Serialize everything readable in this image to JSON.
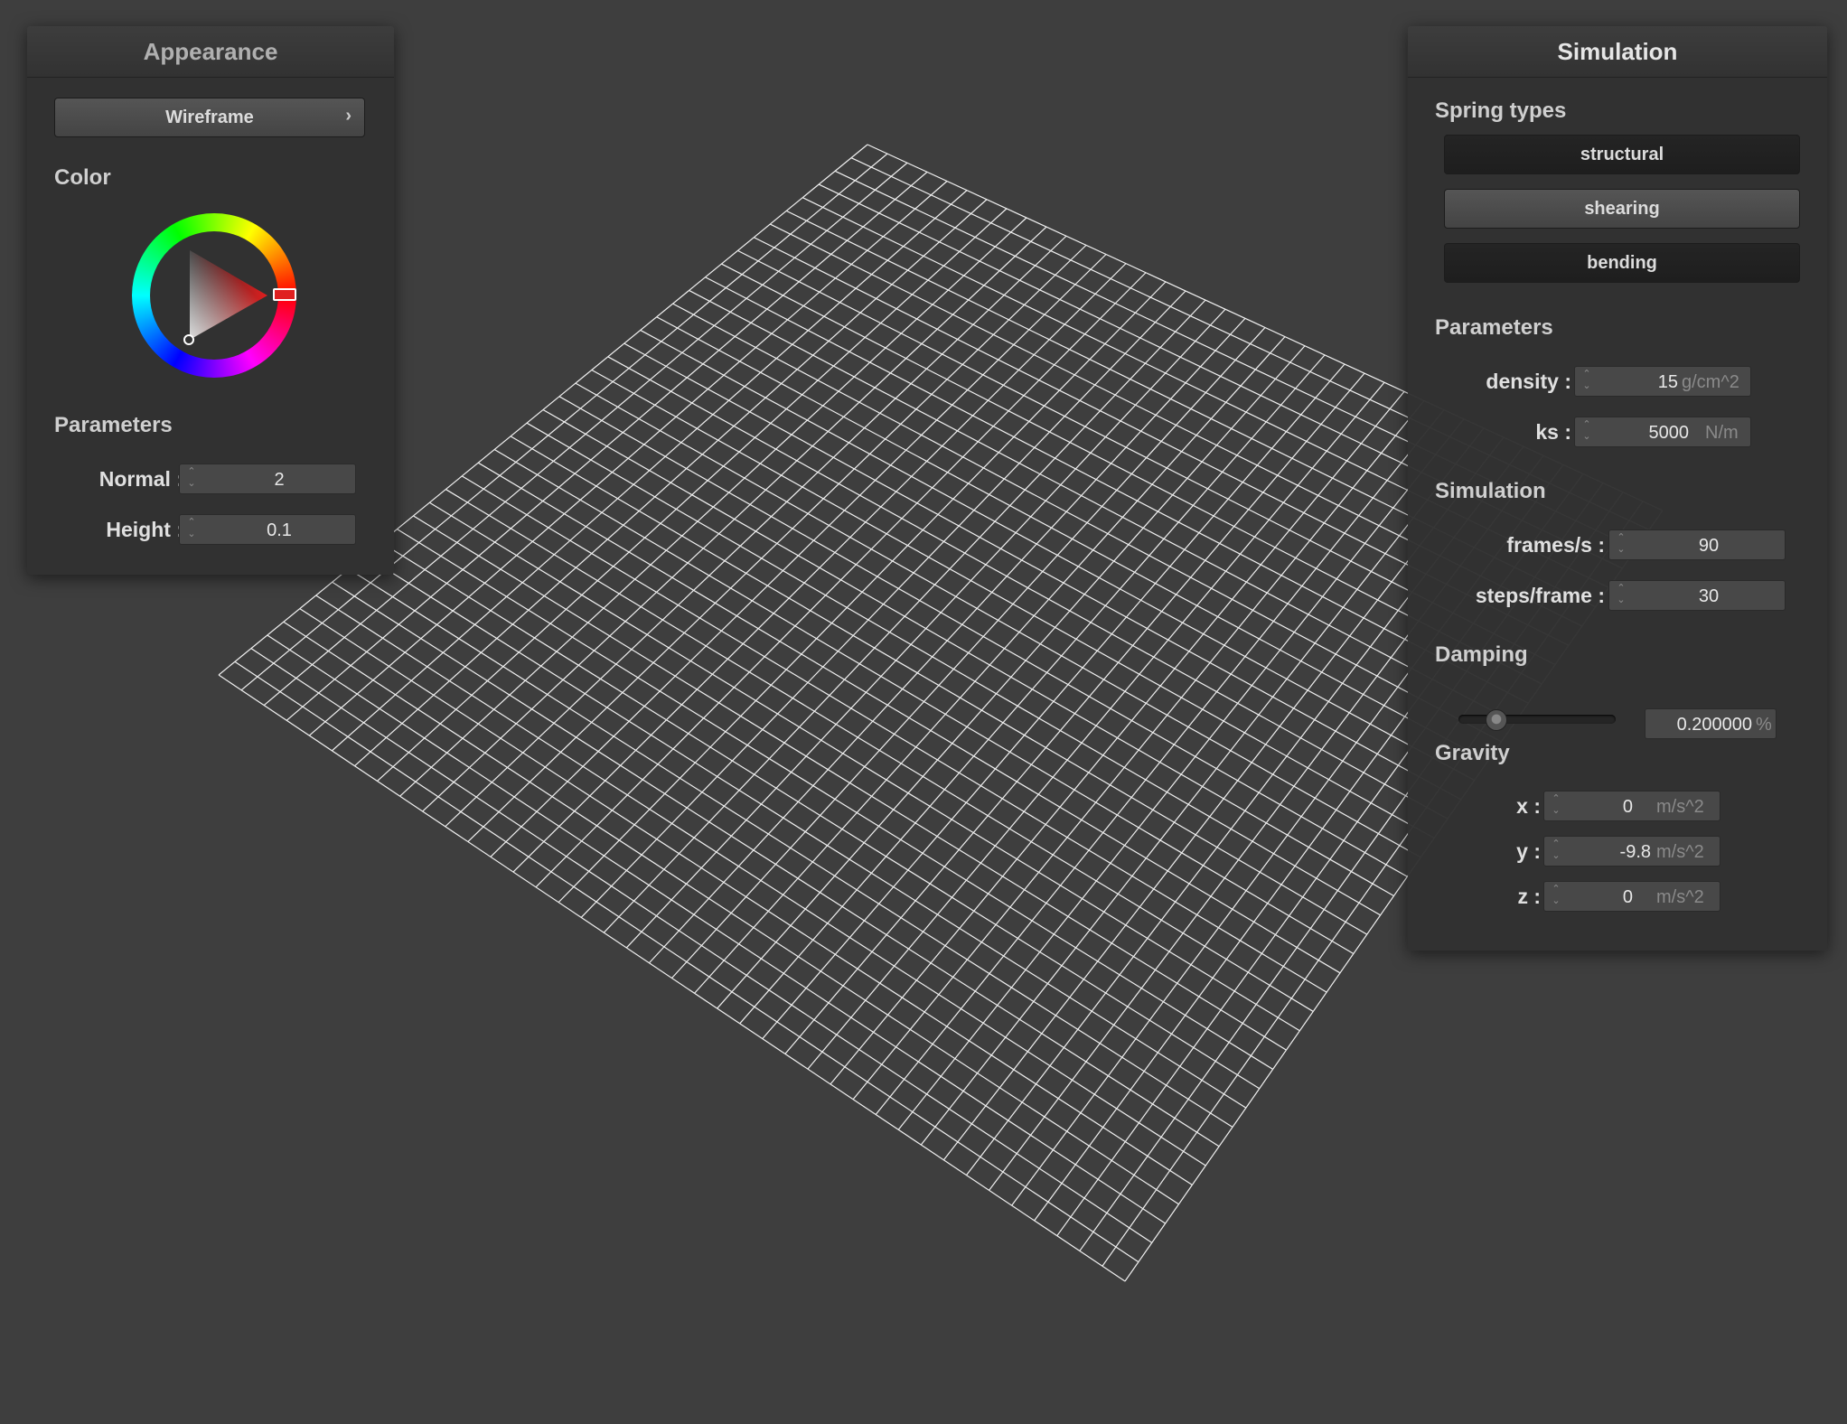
{
  "appearance": {
    "title": "Appearance",
    "mode_label": "Wireframe",
    "color_label": "Color",
    "selected_color": "#e02020",
    "parameters_label": "Parameters",
    "normal_label": "Normal :",
    "normal_value": "2",
    "height_label": "Height :",
    "height_value": "0.1"
  },
  "simulation": {
    "title": "Simulation",
    "spring_types_label": "Spring types",
    "springs": [
      {
        "label": "structural"
      },
      {
        "label": "shearing"
      },
      {
        "label": "bending"
      }
    ],
    "parameters_label": "Parameters",
    "density_label": "density :",
    "density_value": "15",
    "density_unit": "g/cm^2",
    "ks_label": "ks :",
    "ks_value": "5000",
    "ks_unit": "N/m",
    "simulation_label": "Simulation",
    "fps_label": "frames/s :",
    "fps_value": "90",
    "steps_label": "steps/frame :",
    "steps_value": "30",
    "damping_label": "Damping",
    "damping_value": "0.200000",
    "damping_unit": "%",
    "damping_level": 0.2,
    "gravity_label": "Gravity",
    "gravity": [
      {
        "label": "x :",
        "value": "0",
        "unit": "m/s^2"
      },
      {
        "label": "y :",
        "value": "-9.8",
        "unit": "m/s^2"
      },
      {
        "label": "z :",
        "value": "0",
        "unit": "m/s^2"
      }
    ]
  }
}
